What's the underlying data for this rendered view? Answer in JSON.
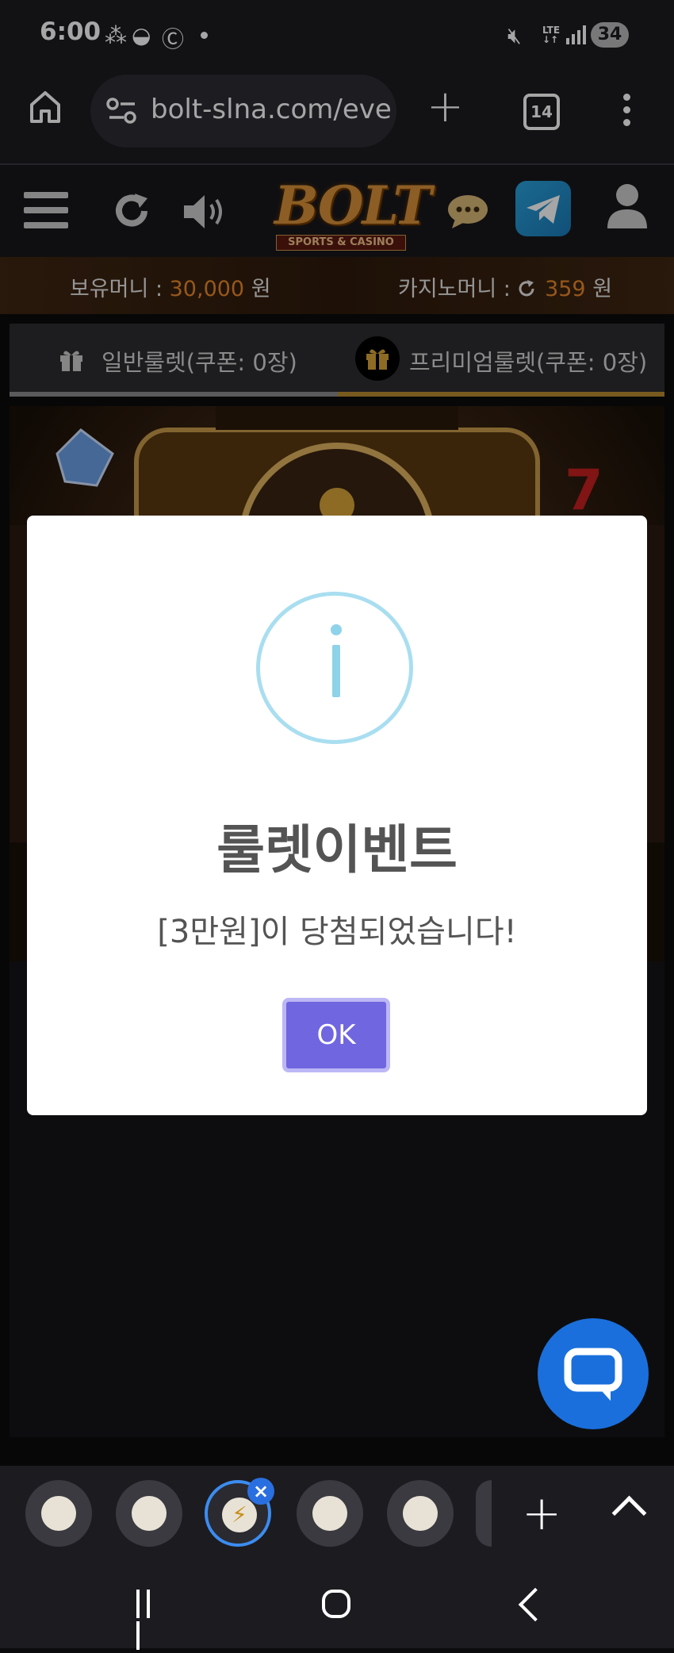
{
  "status_bar": {
    "time": "6:00",
    "battery": "34"
  },
  "browser": {
    "url": "bolt-slna.com/eve",
    "tab_count": "14"
  },
  "site_header": {
    "logo_text": "BOLT",
    "logo_subtitle": "SPORTS & CASINO"
  },
  "money_bar": {
    "holding_label": "보유머니 : ",
    "holding_value": "30,000",
    "holding_unit": " 원",
    "casino_label": "카지노머니 : ",
    "casino_value": "359",
    "casino_unit": " 원"
  },
  "tabs": [
    {
      "label": "일반룰렛(쿠폰: 0장)"
    },
    {
      "label": "프리미엄룰렛(쿠폰: 0장)"
    }
  ],
  "modal": {
    "title": "룰렛이벤트",
    "message": "[3만원]이 당첨되었습니다!",
    "ok_label": "OK"
  },
  "colors": {
    "accent_orange": "#e8872a",
    "ok_button": "#7066e0",
    "chat_fab": "#1a6fdc",
    "info_icon": "#8fd3ea"
  }
}
